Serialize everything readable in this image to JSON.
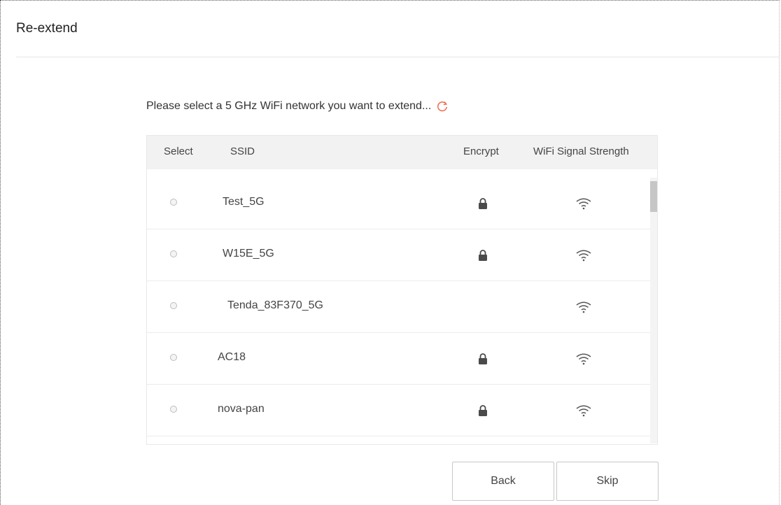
{
  "page": {
    "title": "Re-extend"
  },
  "prompt": {
    "text": "Please select a 5 GHz WiFi network you want to extend..."
  },
  "table": {
    "headers": {
      "select": "Select",
      "ssid": "SSID",
      "encrypt": "Encrypt",
      "signal": "WiFi Signal Strength"
    },
    "rows": [
      {
        "ssid": "Test_5G",
        "encrypted": true,
        "signal_icon": "wifi-full-icon"
      },
      {
        "ssid": "W15E_5G",
        "encrypted": true,
        "signal_icon": "wifi-full-icon"
      },
      {
        "ssid": "Tenda_83F370_5G",
        "encrypted": false,
        "signal_icon": "wifi-full-icon"
      },
      {
        "ssid": "AC18",
        "encrypted": true,
        "signal_icon": "wifi-full-icon"
      },
      {
        "ssid": "nova-pan",
        "encrypted": true,
        "signal_icon": "wifi-full-icon"
      }
    ]
  },
  "buttons": {
    "back": "Back",
    "skip": "Skip"
  },
  "colors": {
    "refresh_icon": "#f06a4a",
    "header_bg": "#f2f2f2",
    "icon_dark": "#4a4a4a"
  }
}
